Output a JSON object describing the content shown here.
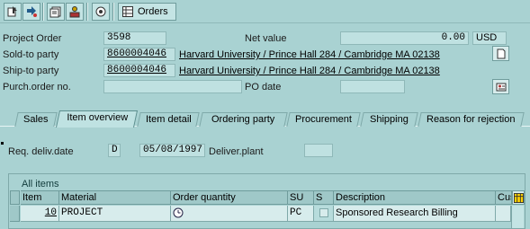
{
  "toolbar": {
    "orders_label": "Orders"
  },
  "header": {
    "project_order_label": "Project Order",
    "project_order_value": "3598",
    "net_value_label": "Net value",
    "net_value_value": "0.00",
    "currency": "USD",
    "sold_to_label": "Sold-to party",
    "sold_to_value": "8600004046",
    "sold_to_address": "Harvard University / Prince Hall 284 / Cambridge MA 02138",
    "ship_to_label": "Ship-to party",
    "ship_to_value": "8600004046",
    "ship_to_address": "Harvard University / Prince Hall 284 / Cambridge MA 02138",
    "purch_order_label": "Purch.order no.",
    "purch_order_value": "",
    "po_date_label": "PO date",
    "po_date_value": ""
  },
  "tabs": [
    {
      "label": "Sales",
      "active": false
    },
    {
      "label": "Item overview",
      "active": true
    },
    {
      "label": "Item detail",
      "active": false
    },
    {
      "label": "Ordering party",
      "active": false
    },
    {
      "label": "Procurement",
      "active": false
    },
    {
      "label": "Shipping",
      "active": false
    },
    {
      "label": "Reason for rejection",
      "active": false
    }
  ],
  "item_overview": {
    "req_deliv_label": "Req. deliv.date",
    "req_deliv_type": "D",
    "req_deliv_date": "05/08/1997",
    "deliver_plant_label": "Deliver.plant",
    "deliver_plant_value": "",
    "table": {
      "title": "All items",
      "columns": [
        "Item",
        "Material",
        "Order quantity",
        "SU",
        "S",
        "Description",
        "Cus"
      ],
      "rows": [
        {
          "item": "10",
          "material": "PROJECT",
          "order_quantity": "",
          "su": "PC",
          "s": "",
          "description": "Sponsored Research Billing",
          "cus": ""
        }
      ]
    }
  },
  "colors": {
    "background": "#a9d2d2",
    "field": "#bfe1e1"
  }
}
